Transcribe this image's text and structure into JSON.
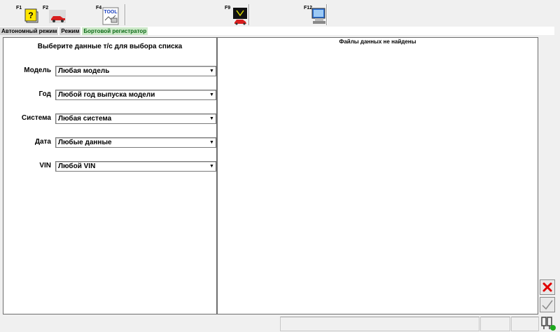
{
  "toolbar": {
    "keys": [
      {
        "key": "F1",
        "icon": "help-icon"
      },
      {
        "key": "F2",
        "icon": "car-icon"
      },
      {
        "key": "F4",
        "icon": "tool-icon"
      },
      {
        "key": "F9",
        "icon": "monitor-car-icon"
      },
      {
        "key": "F12",
        "icon": "screen-capture-icon"
      }
    ],
    "tool_badge": "TOOL"
  },
  "breadcrumb": [
    "Автономный режим",
    "Режим",
    "Бортовой регистратор"
  ],
  "left_panel": {
    "title": "Выберите данные т/с для выбора списка",
    "fields": [
      {
        "label": "Модель",
        "value": "Любая модель"
      },
      {
        "label": "Год",
        "value": "Любой год выпуска модели"
      },
      {
        "label": "Система",
        "value": "Любая система"
      },
      {
        "label": "Дата",
        "value": "Любые данные"
      },
      {
        "label": "VIN",
        "value": "Любой VIN"
      }
    ]
  },
  "right_panel": {
    "message": "Файлы данных не найдены"
  },
  "colors": {
    "cancel": "#e00000",
    "confirm": "#8a8a8a",
    "breadcrumb_active": "#cde8c9"
  }
}
